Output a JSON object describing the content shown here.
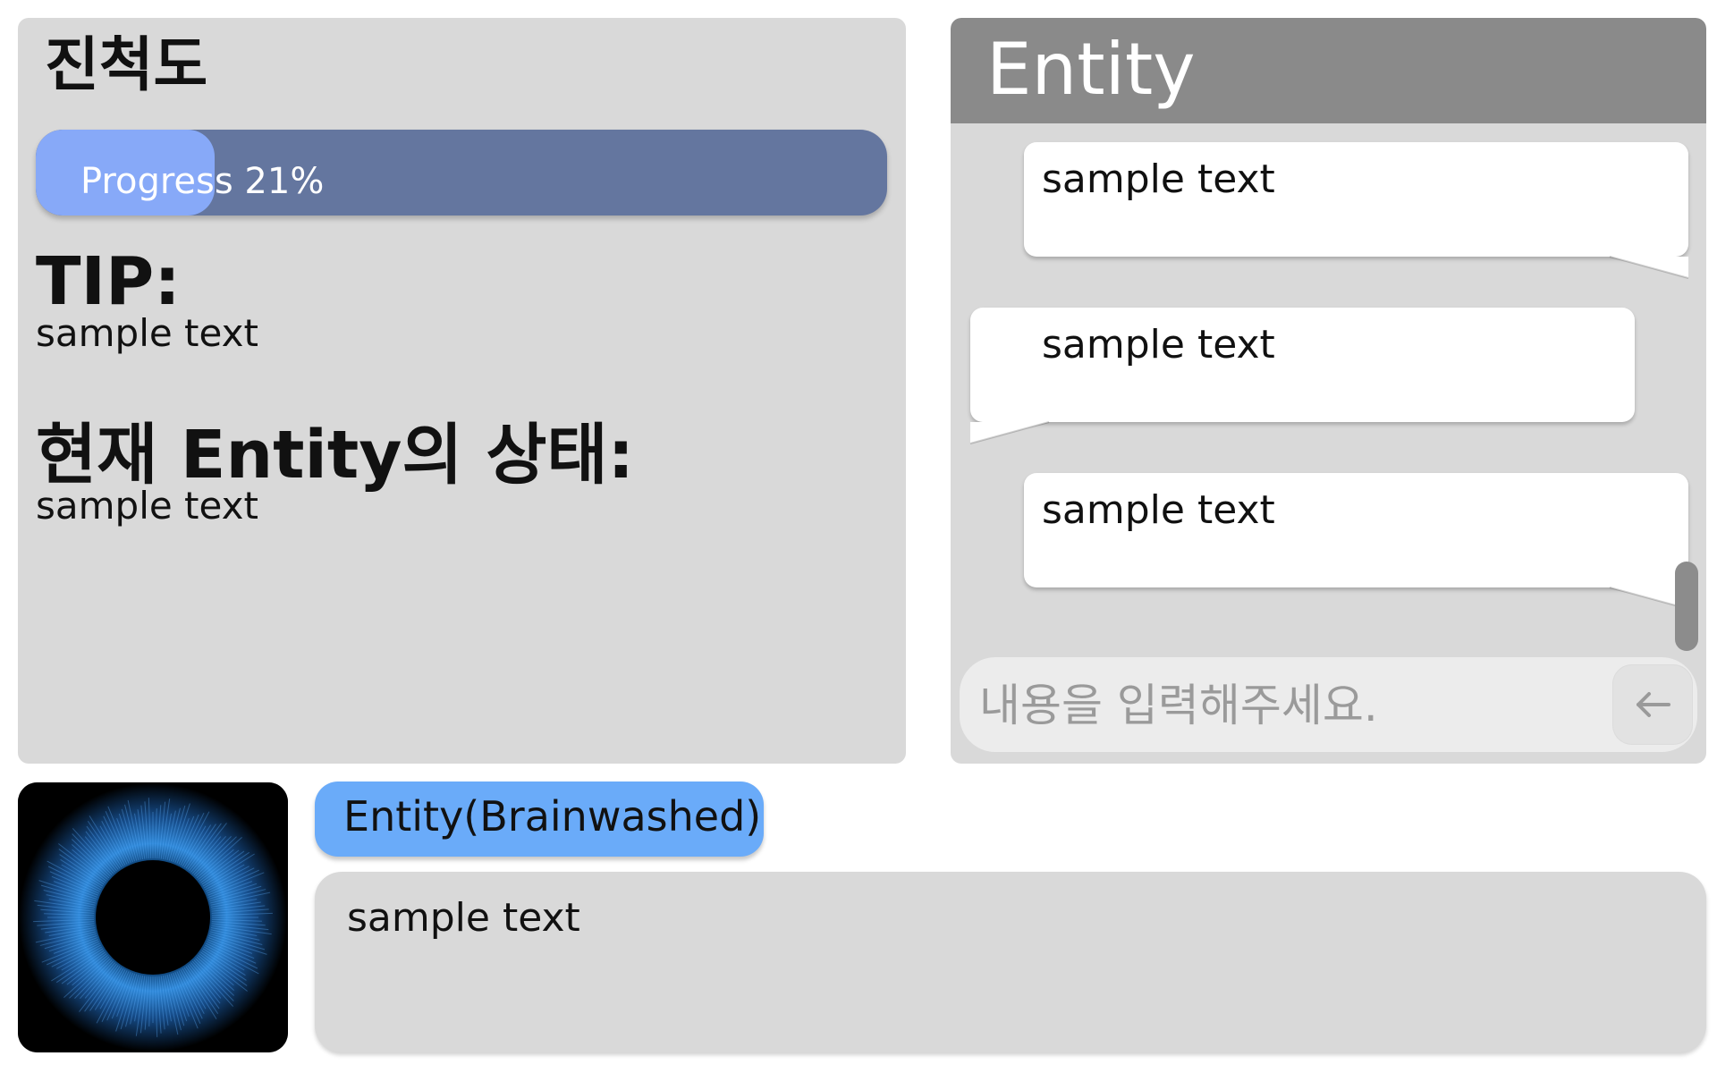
{
  "status_panel": {
    "progress_title": "진척도",
    "progress": {
      "label": "Progress 21%",
      "value": 0.21
    },
    "tip": {
      "heading": "TIP:",
      "text": "sample text"
    },
    "entity_state": {
      "heading": "현재 Entity의 상태:",
      "text": "sample text"
    }
  },
  "chat": {
    "title": "Entity",
    "messages": [
      {
        "text": "sample text",
        "side": "right"
      },
      {
        "text": "sample text",
        "side": "left"
      },
      {
        "text": "sample text",
        "side": "right"
      }
    ],
    "input": {
      "value": "",
      "placeholder": "내용을 입력해주세요."
    },
    "send_icon": "arrow-left-icon"
  },
  "dialog": {
    "portrait_icon": "eye-iris-icon",
    "speaker": "Entity(Brainwashed)",
    "text": "sample text"
  },
  "colors": {
    "panel_bg": "#d9d9d9",
    "header_bg": "#8a8a8a",
    "progress_track": "#64769f",
    "progress_fill": "#87a9f8",
    "speaker_badge": "#6aabf9",
    "bubble_bg": "#ffffff"
  }
}
